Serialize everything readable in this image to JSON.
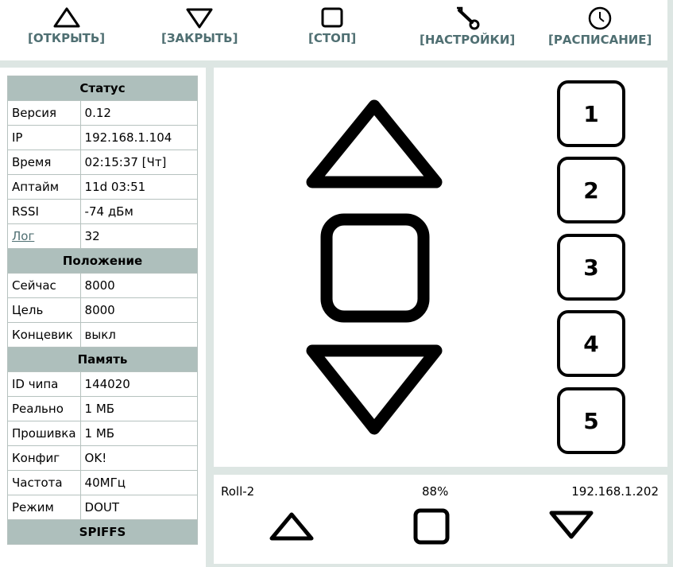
{
  "toolbar": {
    "open": {
      "label": "[ОТКРЫТЬ]",
      "icon": "triangle-up-icon"
    },
    "close": {
      "label": "[ЗАКРЫТЬ]",
      "icon": "triangle-down-icon"
    },
    "stop": {
      "label": "[СТОП]",
      "icon": "square-icon"
    },
    "settings": {
      "label": "[НАСТРОЙКИ]",
      "icon": "wrench-icon"
    },
    "schedule": {
      "label": "[РАСПИСАНИЕ]",
      "icon": "clock-icon"
    }
  },
  "status": {
    "sections": {
      "status": "Статус",
      "position": "Положение",
      "memory": "Память",
      "spiffs": "SPIFFS"
    },
    "version": {
      "key": "Версия",
      "value": "0.12"
    },
    "ip": {
      "key": "IP",
      "value": "192.168.1.104"
    },
    "time": {
      "key": "Время",
      "value": "02:15:37 [Чт]"
    },
    "uptime": {
      "key": "Аптайм",
      "value": "11d 03:51"
    },
    "rssi": {
      "key": "RSSI",
      "value": "-74 дБм"
    },
    "log": {
      "key": "Лог",
      "value": "32"
    },
    "now": {
      "key": "Сейчас",
      "value": "8000"
    },
    "target": {
      "key": "Цель",
      "value": "8000"
    },
    "endstop": {
      "key": "Концевик",
      "value": "выкл"
    },
    "chip_id": {
      "key": "ID чипа",
      "value": "144020"
    },
    "real": {
      "key": "Реально",
      "value": "1 МБ"
    },
    "firmware": {
      "key": "Прошивка",
      "value": "1 МБ"
    },
    "config": {
      "key": "Конфиг",
      "value": "OK!"
    },
    "freq": {
      "key": "Частота",
      "value": "40МГц"
    },
    "mode": {
      "key": "Режим",
      "value": "DOUT"
    }
  },
  "presets": [
    "1",
    "2",
    "3",
    "4",
    "5"
  ],
  "device": {
    "name": "Roll-2",
    "percent": "88%",
    "ip": "192.168.1.202"
  },
  "colors": {
    "background": "#dde6e3",
    "header_fill": "#aebfbc",
    "accent_text": "#4f6f72"
  }
}
